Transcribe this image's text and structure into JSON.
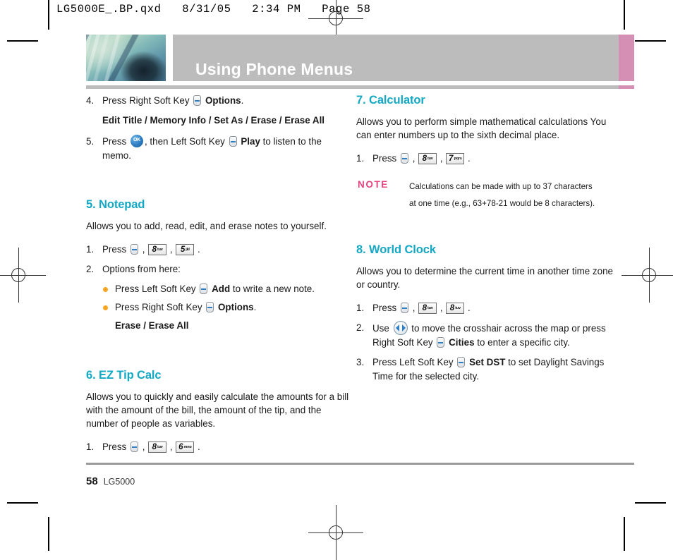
{
  "file_header": "LG5000E_.BP.qxd   8/31/05   2:34 PM   Page 58",
  "chapter": {
    "title": "Using Phone Menus",
    "accent_color": "#d68fb4",
    "band_color": "#bcbcbc"
  },
  "left_column": {
    "continued_steps": [
      {
        "num": "4.",
        "pre": "Press Right Soft Key",
        "icon": "soft-key",
        "bold": "Options",
        "post": ".",
        "sub": "Edit Title / Memory Info / Set As / Erase / Erase All"
      },
      {
        "num": "5.",
        "pre": "Press",
        "icon": "ok-key",
        "mid": ", then Left Soft Key",
        "bold": "Play",
        "post": "to listen to the memo."
      }
    ],
    "sections": [
      {
        "title": "5. Notepad",
        "intro": "Allows you to add, read, edit, and erase notes to yourself.",
        "step1_num": "1.",
        "step1_label": "Press",
        "keys": [
          {
            "digit": "8",
            "letters": "tuv"
          },
          {
            "digit": "5",
            "letters": "jkl"
          }
        ],
        "step2_num": "2.",
        "step2_label": "Options from here:",
        "bullets": [
          {
            "pre": "Press Left Soft Key",
            "bold": "Add",
            "post": "to write a new note."
          },
          {
            "pre": "Press Right Soft Key",
            "bold": "Options",
            "post": "."
          }
        ],
        "bullet_sub": "Erase / Erase All"
      },
      {
        "title": "6. EZ Tip Calc",
        "intro": "Allows you to quickly and easily calculate the amounts for a bill with the amount of the bill, the amount of the tip, and the number of people as variables.",
        "step1_num": "1.",
        "step1_label": "Press",
        "keys": [
          {
            "digit": "8",
            "letters": "tuv"
          },
          {
            "digit": "6",
            "letters": "mno"
          }
        ]
      }
    ]
  },
  "right_column": {
    "calculator": {
      "title": "7. Calculator",
      "intro": "Allows you to perform simple mathematical calculations You can enter numbers up to the sixth decimal place.",
      "step1_num": "1.",
      "step1_label": "Press",
      "keys": [
        {
          "digit": "8",
          "letters": "tuv"
        },
        {
          "digit": "7",
          "letters": "pqrs"
        }
      ],
      "note": {
        "label": "NOTE",
        "line1": "Calculations can be made with up to 37 characters",
        "line2": "at one time (e.g., 63+78-21 would be 8 characters).",
        "color": "#e4447f"
      }
    },
    "world_clock": {
      "title": "8. World Clock",
      "intro": "Allows you to determine the current time in another time zone or country.",
      "step1_num": "1.",
      "step1_label": "Press",
      "keys": [
        {
          "digit": "8",
          "letters": "tuv"
        },
        {
          "digit": "8",
          "letters": "tuv"
        }
      ],
      "step2_num": "2.",
      "step2_pre": "Use",
      "step2_mid": "to move the crosshair across the map or press Right Soft Key",
      "step2_bold": "Cities",
      "step2_post": "to enter a specific city.",
      "step3_num": "3.",
      "step3_pre": "Press Left Soft Key",
      "step3_bold": "Set DST",
      "step3_post": "to set Daylight Savings Time for the selected city."
    }
  },
  "footer": {
    "page_number": "58",
    "model": "LG5000"
  }
}
